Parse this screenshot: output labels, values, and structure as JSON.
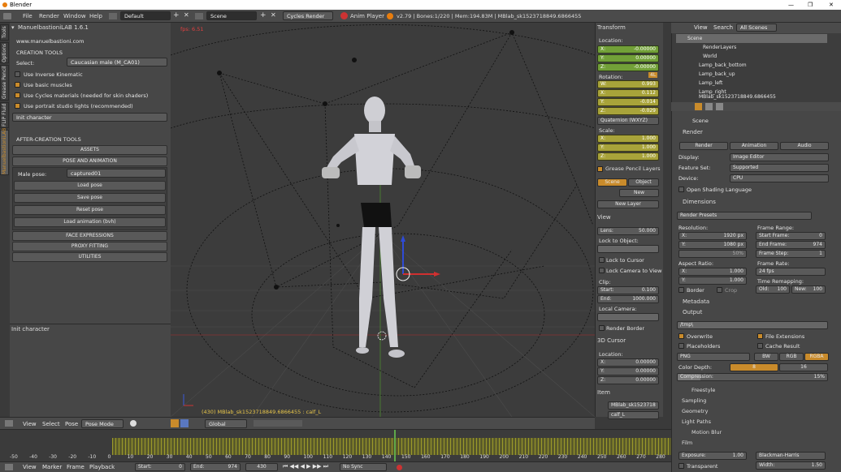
{
  "window": {
    "title": "Blender",
    "min": "—",
    "max": "❐",
    "close": "✕"
  },
  "menu": {
    "file": "File",
    "render": "Render",
    "window": "Window",
    "help": "Help",
    "layout": "Default",
    "scene": "Scene",
    "engine": "Cycles Render",
    "anim_player": "Anim Player",
    "status": "v2.79 | Bones:1/220 | Mem:194.83M | MBlab_sk1523718849.6866455"
  },
  "left_tabs": [
    "Tools",
    "Options",
    "Grease Pencil",
    "FLIP Fluid",
    "ManuelbastioniLAB"
  ],
  "lab": {
    "title": "ManuelbastioniLAB 1.6.1",
    "url": "www.manuelbastioni.com",
    "creation_tools": "CREATION TOOLS",
    "select_label": "Select:",
    "select_value": "Caucasian male (M_CA01)",
    "use_ik": "Use Inverse Kinematic",
    "basic_muscles": "Use basic muscles",
    "cycles_materials": "Use Cycles materials (needed for skin shaders)",
    "portrait_lights": "Use portrait studio lights (recommended)",
    "init_character": "Init character",
    "after_creation": "AFTER-CREATION TOOLS",
    "assets": "ASSETS",
    "pose_anim": "POSE AND ANIMATION",
    "male_pose_label": "Male pose:",
    "male_pose_value": "captured01",
    "load_pose": "Load pose",
    "save_pose": "Save pose",
    "reset_pose": "Reset pose",
    "load_anim": "Load animation (bvh)",
    "face_expr": "FACE EXPRESSIONS",
    "proxy": "PROXY FITTING",
    "utilities": "UTILITIES",
    "operator_panel": "Init character"
  },
  "viewport": {
    "fps": "fps: 6.51",
    "info": "(430) MBlab_sk1523718849.6866455 : calf_L"
  },
  "view3d_header": {
    "view": "View",
    "select": "Select",
    "pose": "Pose",
    "mode": "Pose Mode",
    "orientation": "Global"
  },
  "transform": {
    "title": "Transform",
    "location": "Location:",
    "loc": [
      [
        "X:",
        "-0.00000"
      ],
      [
        "Y:",
        "0.00000"
      ],
      [
        "Z:",
        "-0.00000"
      ]
    ],
    "rotation": "Rotation:",
    "rot_badge": "4L",
    "rot": [
      [
        "W:",
        "0.993"
      ],
      [
        "X:",
        "0.112"
      ],
      [
        "Y:",
        "-0.014"
      ],
      [
        "Z:",
        "-0.029"
      ]
    ],
    "rot_mode": "Quaternion (WXYZ)",
    "scale": "Scale:",
    "scl": [
      [
        "X:",
        "1.000"
      ],
      [
        "Y:",
        "1.000"
      ],
      [
        "Z:",
        "1.000"
      ]
    ]
  },
  "gp_layers": {
    "title": "Grease Pencil Layers",
    "scene": "Scene",
    "object": "Object",
    "new": "New",
    "new_layer": "New Layer"
  },
  "view_panel": {
    "title": "View",
    "lens_label": "Lens:",
    "lens": "50.000",
    "lock_obj": "Lock to Object:",
    "lock_cursor": "Lock to Cursor",
    "lock_cam": "Lock Camera to View",
    "clip": "Clip:",
    "start_label": "Start:",
    "start": "0.100",
    "end_label": "End:",
    "end": "1000.000",
    "local_cam": "Local Camera:",
    "render_border": "Render Border"
  },
  "cursor": {
    "title": "3D Cursor",
    "location": "Location:",
    "x": "0.00000",
    "y": "0.00000",
    "z": "0.00000"
  },
  "item": {
    "title": "Item",
    "name": "MBlab_sk1523718",
    "bone": "calf_L"
  },
  "outliner": {
    "view": "View",
    "search": "Search",
    "scenes": "All Scenes",
    "items": [
      "Scene",
      "RenderLayers",
      "World",
      "Lamp_back_bottom",
      "Lamp_back_up",
      "Lamp_left",
      "Lamp_right",
      "MBlab_sk1523718849.6866455"
    ]
  },
  "props": {
    "scene": "Scene",
    "render": "Render",
    "render_btn": "Render",
    "animation_btn": "Animation",
    "audio_btn": "Audio",
    "display_label": "Display:",
    "display": "Image Editor",
    "feature_label": "Feature Set:",
    "feature": "Supported",
    "device_label": "Device:",
    "device": "CPU",
    "osl": "Open Shading Language",
    "dimensions": "Dimensions",
    "presets": "Render Presets",
    "resolution": "Resolution:",
    "res_x": "1920 px",
    "res_y": "1080 px",
    "res_pct": "50%",
    "frame_range": "Frame Range:",
    "start_frame": "0",
    "end_frame": "974",
    "frame_step": "1",
    "aspect": "Aspect Ratio:",
    "asp_x": "1.000",
    "asp_y": "1.000",
    "frame_rate": "Frame Rate:",
    "fps": "24 fps",
    "time_remap": "Time Remapping:",
    "old": "100",
    "new": "100",
    "border": "Border",
    "crop": "Crop",
    "metadata": "Metadata",
    "output": "Output",
    "path": "/tmp\\",
    "overwrite": "Overwrite",
    "file_ext": "File Extensions",
    "placeholders": "Placeholders",
    "cache": "Cache Result",
    "format": "PNG",
    "bw": "BW",
    "rgb": "RGB",
    "rgba": "RGBA",
    "color_depth": "Color Depth:",
    "depth8": "8",
    "depth16": "16",
    "compression": "Compression:",
    "compression_val": "15%",
    "freestyle": "Freestyle",
    "sampling": "Sampling",
    "geometry": "Geometry",
    "light_paths": "Light Paths",
    "motion_blur": "Motion Blur",
    "film": "Film",
    "exposure_label": "Exposure:",
    "exposure": "1.00",
    "filter": "Blackman-Harris",
    "transparent": "Transparent",
    "width_label": "Width:",
    "width": "1.50"
  },
  "timeline": {
    "ticks": [
      "-50",
      "-40",
      "-30",
      "-20",
      "-10",
      "0",
      "10",
      "20",
      "30",
      "40",
      "50",
      "60",
      "70",
      "80",
      "90",
      "100",
      "110",
      "120",
      "130",
      "140",
      "150",
      "160",
      "170",
      "180",
      "190",
      "200",
      "210",
      "220",
      "230",
      "240",
      "250",
      "260",
      "270",
      "280"
    ],
    "view": "View",
    "marker": "Marker",
    "frame": "Frame",
    "playback": "Playback",
    "start_label": "Start:",
    "start": "0",
    "end_label": "End:",
    "end": "974",
    "current": "430",
    "sync": "No Sync"
  },
  "colors": {
    "accent": "#c98b2b",
    "green": "#72a038",
    "yellow": "#a8a33a"
  }
}
